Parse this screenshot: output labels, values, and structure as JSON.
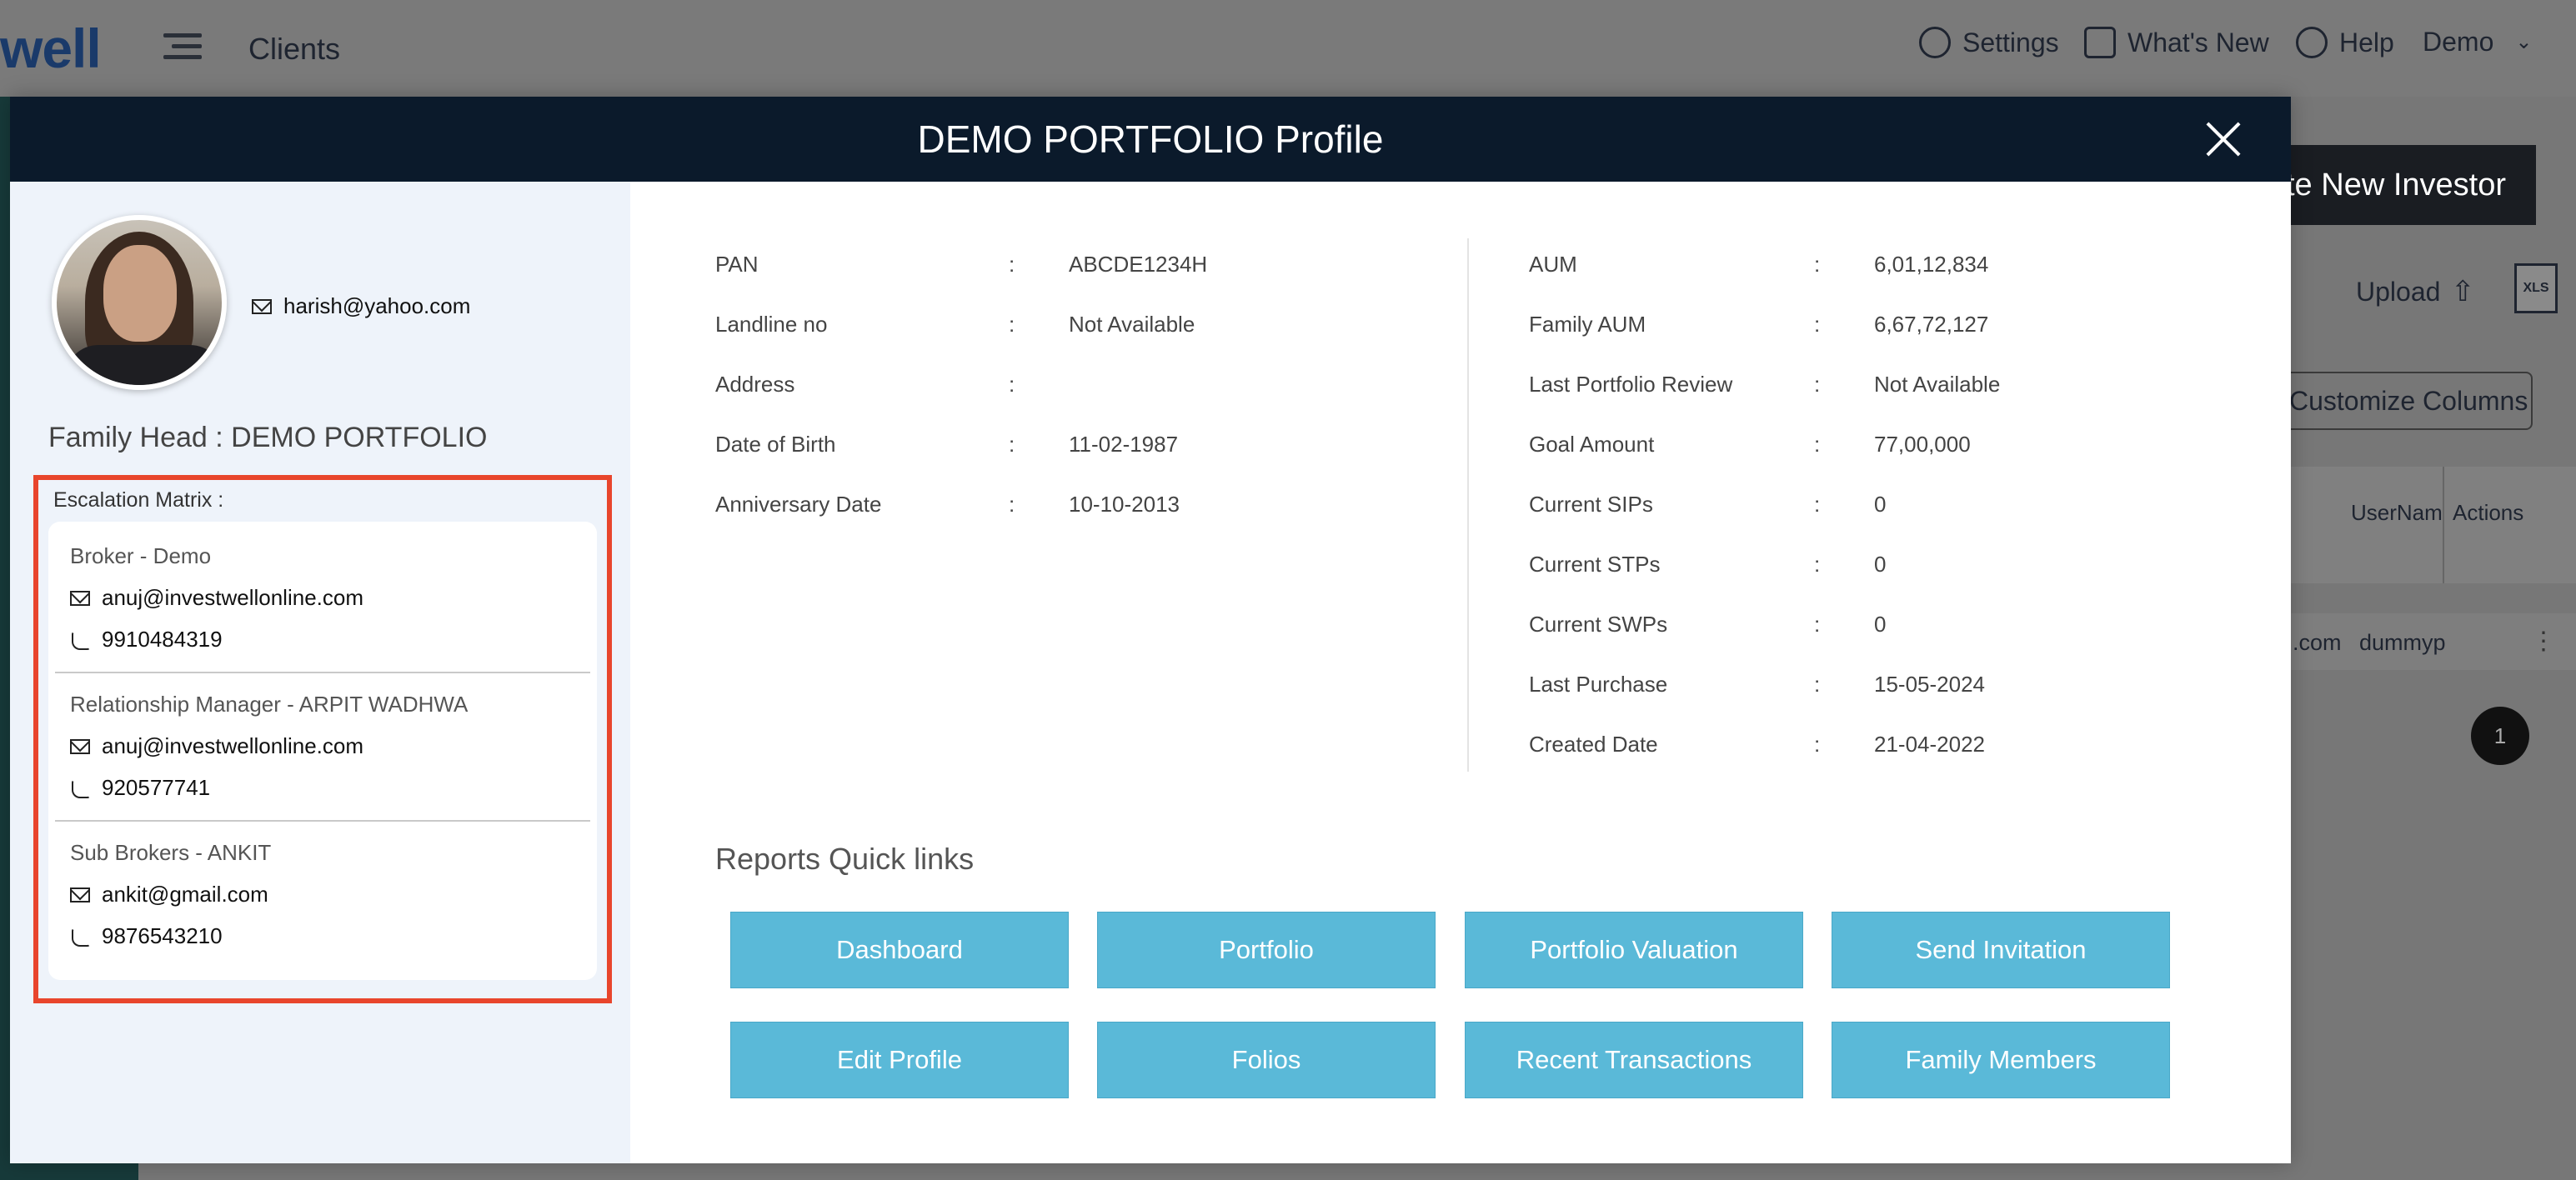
{
  "background": {
    "logo_text": "well",
    "page_title": "Clients",
    "nav": [
      {
        "label": "Settings"
      },
      {
        "label": "What's New"
      },
      {
        "label": "Help"
      },
      {
        "label": "Demo"
      }
    ],
    "create_button": "te New Investor",
    "upload_label": "Upload",
    "xls_label": "XLS",
    "customize_button": "Customize Columns",
    "table_headers": [
      "UserNam",
      "Actions"
    ],
    "table_row": [
      ".com",
      "dummyp"
    ],
    "page_number": "1"
  },
  "modal": {
    "title": "DEMO PORTFOLIO Profile",
    "header_email": "harish@yahoo.com",
    "family_head": "Family Head : DEMO PORTFOLIO",
    "escalation": {
      "label": "Escalation Matrix :",
      "entries": [
        {
          "role": "Broker - Demo",
          "email": "anuj@investwellonline.com",
          "phone": "9910484319"
        },
        {
          "role": "Relationship Manager - ARPIT WADHWA",
          "email": "anuj@investwellonline.com",
          "phone": "920577741"
        },
        {
          "role": "Sub Brokers - ANKIT",
          "email": "ankit@gmail.com",
          "phone": "9876543210"
        }
      ]
    },
    "left_details": [
      {
        "label": "PAN",
        "value": "ABCDE1234H"
      },
      {
        "label": "Landline no",
        "value": "Not Available"
      },
      {
        "label": "Address",
        "value": ""
      },
      {
        "label": "Date of Birth",
        "value": "11-02-1987"
      },
      {
        "label": "Anniversary Date",
        "value": "10-10-2013"
      }
    ],
    "right_details": [
      {
        "label": "AUM",
        "value": "6,01,12,834"
      },
      {
        "label": "Family AUM",
        "value": "6,67,72,127"
      },
      {
        "label": "Last Portfolio Review",
        "value": "Not Available"
      },
      {
        "label": "Goal Amount",
        "value": "77,00,000"
      },
      {
        "label": "Current SIPs",
        "value": "0"
      },
      {
        "label": "Current STPs",
        "value": "0"
      },
      {
        "label": "Current SWPs",
        "value": "0"
      },
      {
        "label": "Last Purchase",
        "value": "15-05-2024"
      },
      {
        "label": "Created Date",
        "value": "21-04-2022"
      }
    ],
    "separator": ":",
    "quick_links_title": "Reports Quick links",
    "quick_links": [
      {
        "label": "Dashboard"
      },
      {
        "label": "Portfolio"
      },
      {
        "label": "Portfolio Valuation"
      },
      {
        "label": "Send Invitation"
      },
      {
        "label": "Edit Profile"
      },
      {
        "label": "Folios"
      },
      {
        "label": "Recent Transactions"
      },
      {
        "label": "Family Members"
      }
    ]
  },
  "colors": {
    "modal_header": "#0b1a2b",
    "quick_link_button": "#5ab9d8",
    "highlight_border": "#e8452c",
    "left_pane": "#eef3fa"
  }
}
